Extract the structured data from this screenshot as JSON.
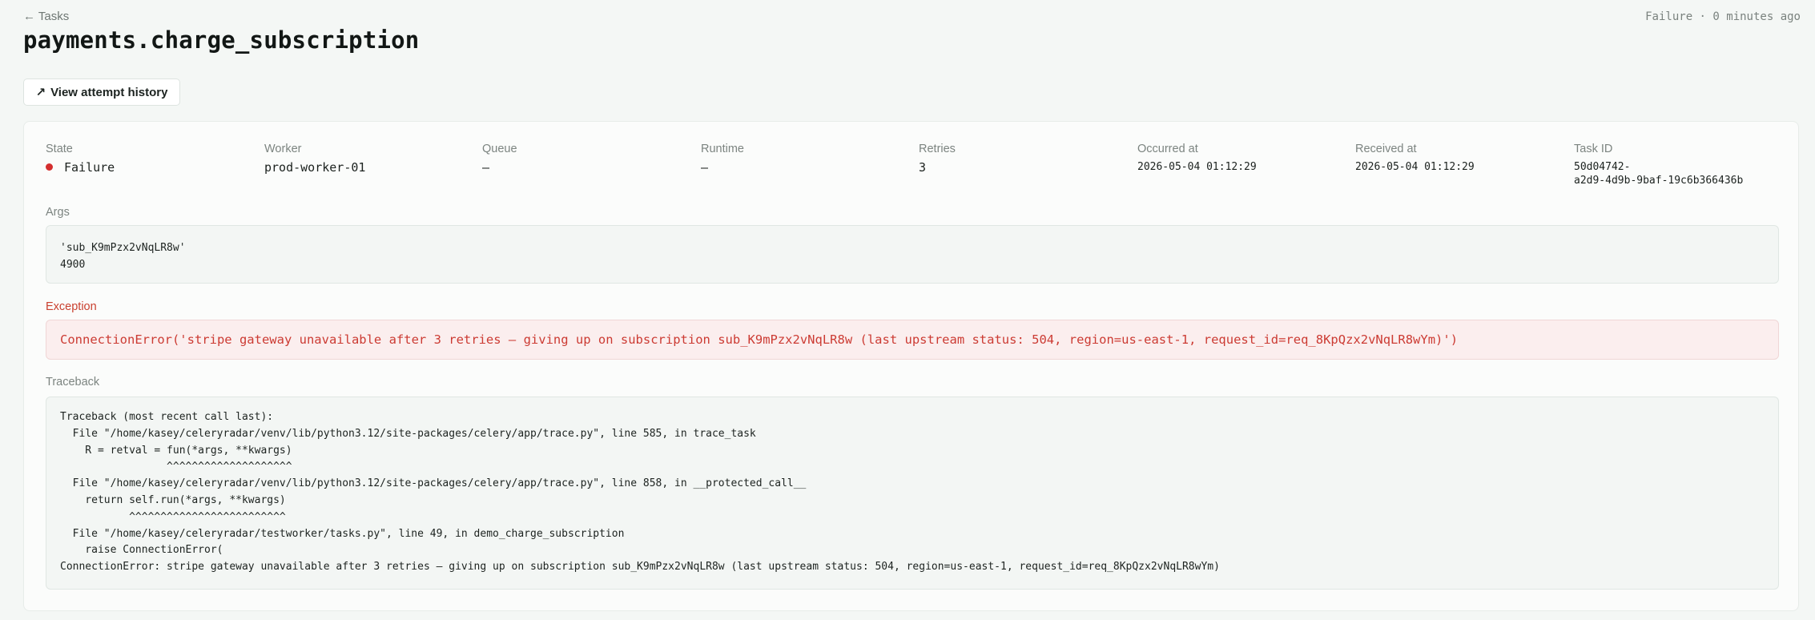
{
  "header": {
    "back_link": "← Tasks",
    "status_summary": "Failure · 0 minutes ago",
    "title": "payments.charge_subscription",
    "history_button": "View attempt history",
    "history_icon": "arrow-up-right-icon"
  },
  "meta": {
    "state": {
      "label": "State",
      "value": "Failure",
      "dot_color": "#d42e2e"
    },
    "worker": {
      "label": "Worker",
      "value": "prod-worker-01"
    },
    "queue": {
      "label": "Queue",
      "value": "—"
    },
    "runtime": {
      "label": "Runtime",
      "value": "—"
    },
    "retries": {
      "label": "Retries",
      "value": "3"
    },
    "occurred_at": {
      "label": "Occurred at",
      "value": "2026-05-04 01:12:29"
    },
    "received_at": {
      "label": "Received at",
      "value": "2026-05-04 01:12:29"
    },
    "task_id": {
      "label": "Task ID",
      "value": "50d04742-\na2d9-4d9b-9baf-19c6b366436b"
    }
  },
  "args": {
    "label": "Args",
    "content": "'sub_K9mPzx2vNqLR8w'\n4900"
  },
  "exception": {
    "label": "Exception",
    "content": "ConnectionError('stripe gateway unavailable after 3 retries — giving up on subscription sub_K9mPzx2vNqLR8w (last upstream status: 504, region=us-east-1, request_id=req_8KpQzx2vNqLR8wYm)')"
  },
  "traceback": {
    "label": "Traceback",
    "content": "Traceback (most recent call last):\n  File \"/home/kasey/celeryradar/venv/lib/python3.12/site-packages/celery/app/trace.py\", line 585, in trace_task\n    R = retval = fun(*args, **kwargs)\n                 ^^^^^^^^^^^^^^^^^^^^\n  File \"/home/kasey/celeryradar/venv/lib/python3.12/site-packages/celery/app/trace.py\", line 858, in __protected_call__\n    return self.run(*args, **kwargs)\n           ^^^^^^^^^^^^^^^^^^^^^^^^^\n  File \"/home/kasey/celeryradar/testworker/tasks.py\", line 49, in demo_charge_subscription\n    raise ConnectionError(\nConnectionError: stripe gateway unavailable after 3 retries — giving up on subscription sub_K9mPzx2vNqLR8w (last upstream status: 504, region=us-east-1, request_id=req_8KpQzx2vNqLR8wYm)"
  },
  "colors": {
    "background": "#f4f7f5",
    "failure": "#d42e2e",
    "exception_text": "#cc3b33",
    "exception_bg": "#fbeeee"
  }
}
